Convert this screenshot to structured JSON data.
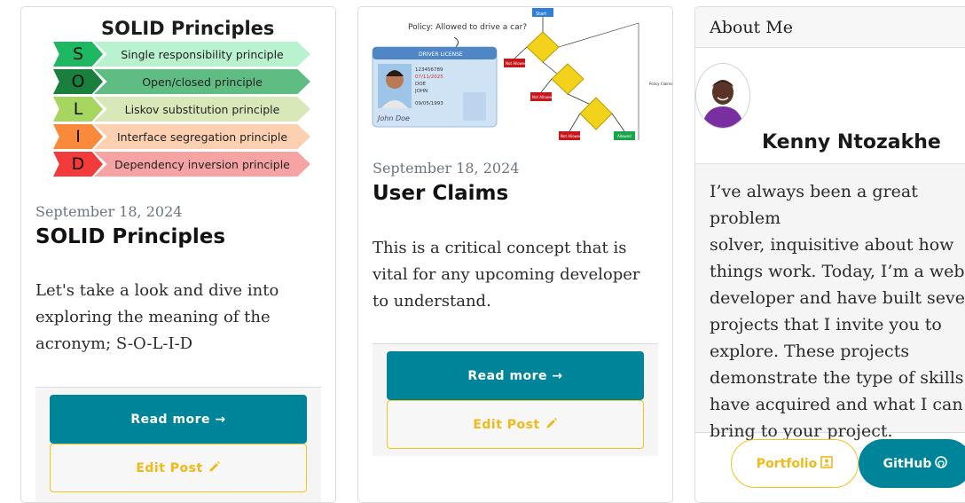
{
  "posts": [
    {
      "date": "September 18, 2024",
      "title": "SOLID Principles",
      "excerpt": "Let's take a look and dive into exploring the meaning of the acronym; S-O-L-I-D",
      "read_more_label": "Read more →",
      "edit_label": "Edit Post",
      "image": {
        "heading": "SOLID Principles",
        "rows": [
          {
            "letter": "S",
            "label": "Single responsibility principle",
            "letter_color": "#1fb862",
            "label_color": "#b8f2cf"
          },
          {
            "letter": "O",
            "label": "Open/closed principle",
            "letter_color": "#1a7f3c",
            "label_color": "#5fbd83"
          },
          {
            "letter": "L",
            "label": "Liskov substitution principle",
            "letter_color": "#a6d65f",
            "label_color": "#d9e8b8"
          },
          {
            "letter": "I",
            "label": "Interface segregation principle",
            "letter_color": "#f98a3c",
            "label_color": "#fcd0b0"
          },
          {
            "letter": "D",
            "label": "Dependency inversion principle",
            "letter_color": "#f33b3b",
            "label_color": "#f5a3a3"
          }
        ]
      }
    },
    {
      "date": "September 18, 2024",
      "title": "User Claims",
      "excerpt": "This is a critical concept that is vital for any upcoming developer to understand.",
      "read_more_label": "Read more →",
      "edit_label": "Edit Post",
      "image": {
        "question": "Policy: Allowed to drive a car?",
        "license_header": "DRIVER LICENSE",
        "license_lines": [
          "123456789",
          "07/11/2025",
          "DOE",
          "JOHN",
          "09/05/1993"
        ],
        "flow_labels": {
          "start": "Start",
          "not_allowed": "Not Allowed",
          "allowed": "Allowed",
          "policy_claims": "Policy Claims"
        }
      }
    }
  ],
  "about": {
    "header": "About Me",
    "name": "Kenny Ntozakhe",
    "bio": "I’ve always been a great problem\nsolver, inquisitive about how\nthings work. Today, I’m a web\ndeveloper and have built several\nprojects that I invite you to\nexplore. These projects\ndemonstrate the type of skills I\nhave acquired and what I can\nbring to your project.",
    "portfolio_label": "Portfolio",
    "github_label": "GitHub"
  },
  "colors": {
    "primary": "#00849a",
    "warning": "#f3b817"
  }
}
